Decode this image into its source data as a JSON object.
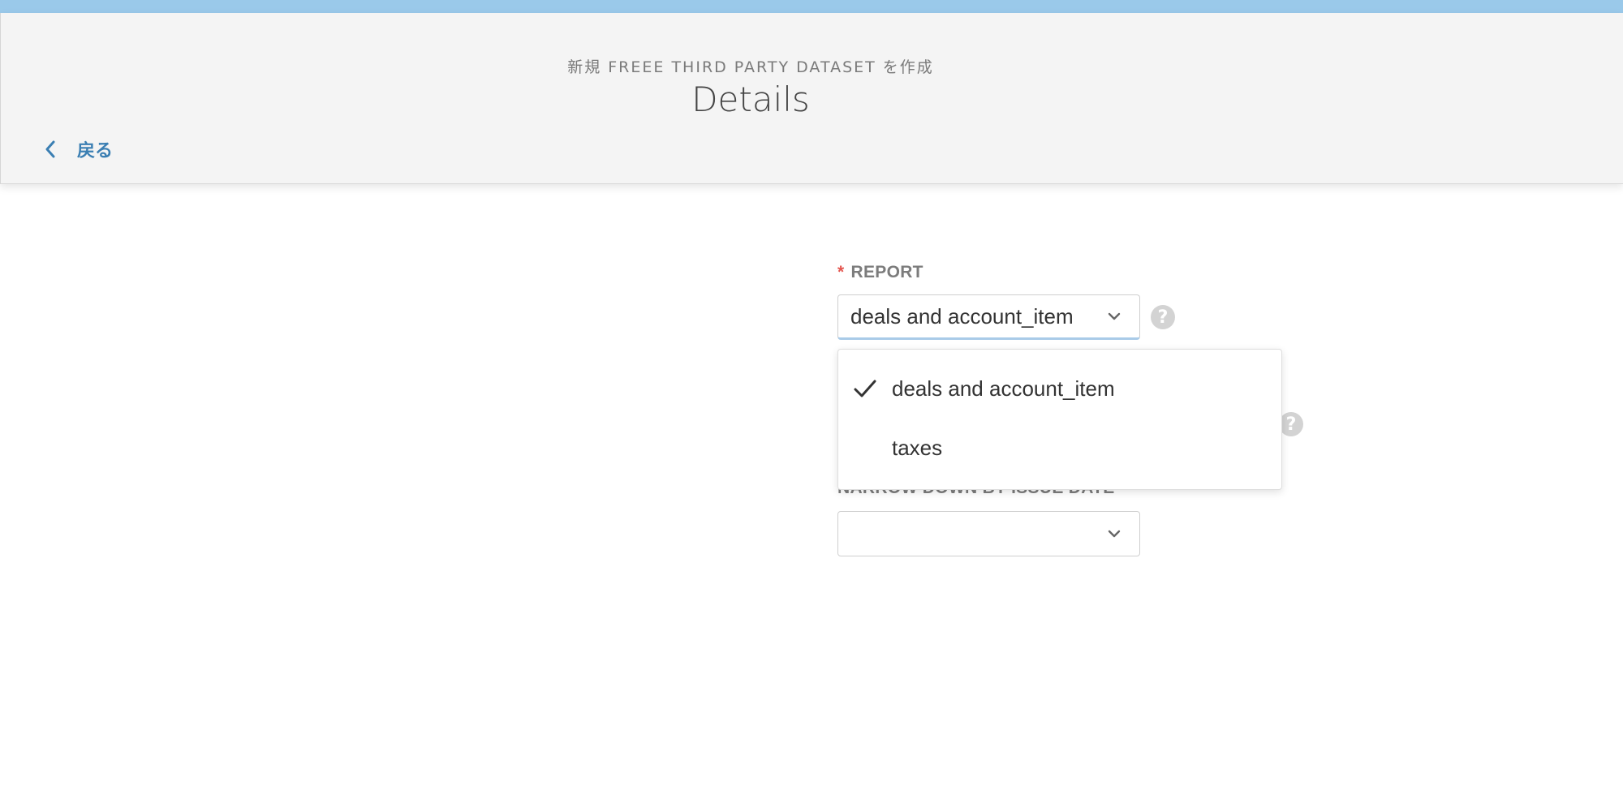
{
  "header": {
    "subtitle": "新規 FREEE THIRD PARTY DATASET を作成",
    "title": "Details",
    "back_label": "戻る"
  },
  "form": {
    "report": {
      "label": "REPORT",
      "required_mark": "*",
      "value": "deals and account_item",
      "help_glyph": "?"
    },
    "second_help_glyph": "?",
    "issue_date": {
      "label": "NARROW DOWN BY ISSUE DATE",
      "value": ""
    }
  },
  "dropdown": {
    "options": [
      {
        "label": "deals and account_item",
        "selected": true
      },
      {
        "label": "taxes",
        "selected": false
      }
    ]
  },
  "colors": {
    "accent_blue": "#3b7fb3",
    "top_strip": "#9ac9ea",
    "required_red": "#e4564f",
    "header_bg": "#f4f4f4"
  },
  "icons": {
    "back": "chevron-left-icon",
    "select": "chevron-down-icon",
    "help": "question-circle-icon",
    "selected_option": "check-icon"
  }
}
